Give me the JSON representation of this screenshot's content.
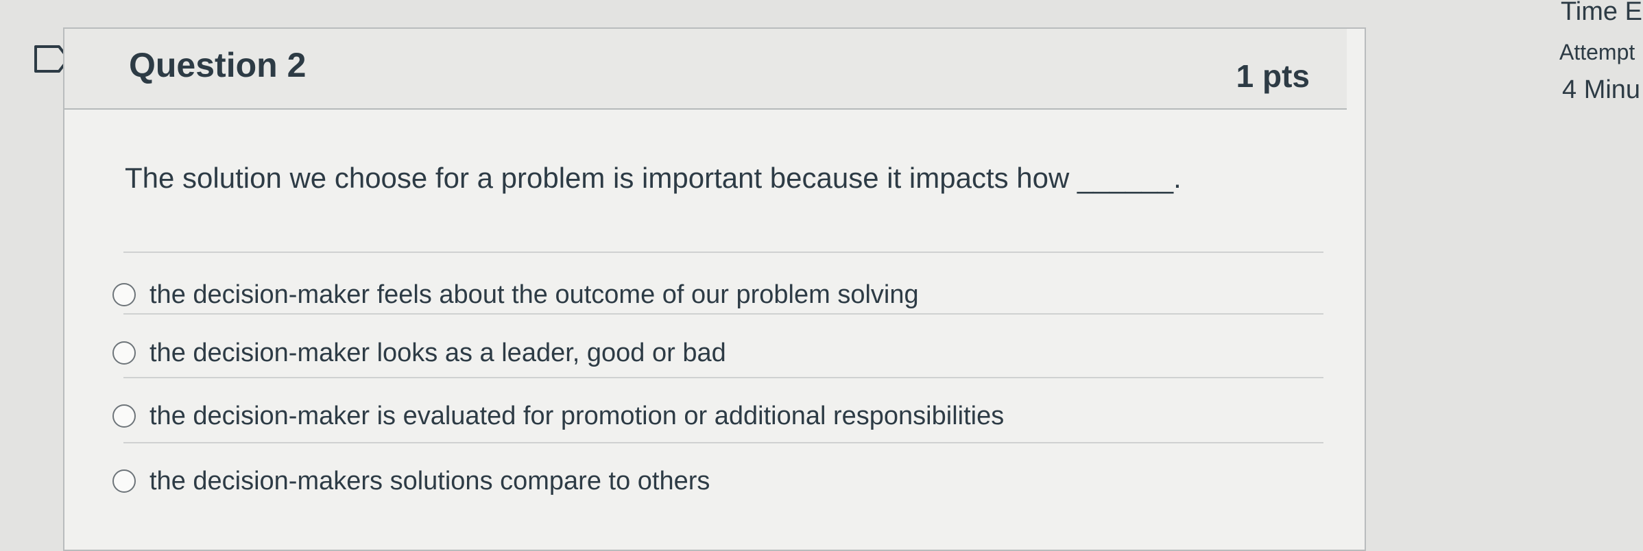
{
  "question": {
    "title": "Question 2",
    "points": "1 pts",
    "text": "The solution we choose for a problem is important because it impacts how ______.",
    "answers": [
      {
        "label": "the decision-maker feels about the outcome of our problem solving"
      },
      {
        "label": "the decision-maker looks as a leader, good or bad"
      },
      {
        "label": "the decision-maker is evaluated for promotion or additional responsibilities"
      },
      {
        "label": "the decision-makers solutions compare to others"
      }
    ]
  },
  "sidebar": {
    "time_label": "Time E",
    "attempt_label": "Attempt",
    "minutes_label": "4 Minu"
  },
  "icons": {
    "flag": "flag-question-icon",
    "radio": "radio-unselected-icon"
  },
  "colors": {
    "text": "#2d3b45",
    "background": "#e3e3e1",
    "panel": "#f1f1ef",
    "header": "#e8e8e6",
    "border": "#b9bcbd"
  }
}
